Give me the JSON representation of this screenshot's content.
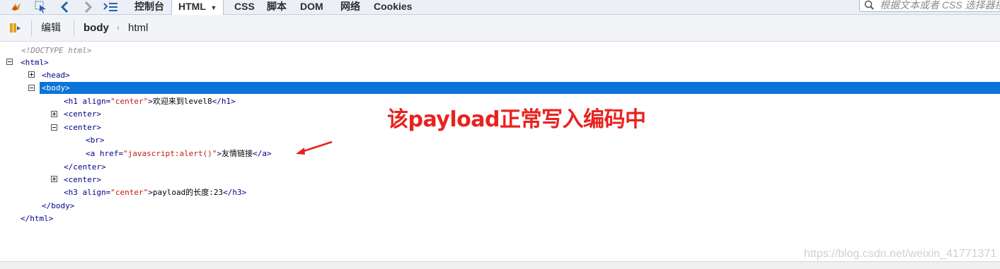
{
  "toolbar": {
    "tabs": [
      "控制台",
      "HTML",
      "CSS",
      "脚本",
      "DOM",
      "网络",
      "Cookies"
    ],
    "active_tab_index": 1,
    "search_placeholder": "根据文本或者 CSS 选择器搜"
  },
  "crumbbar": {
    "edit_label": "编辑",
    "crumbs": [
      "body",
      "html"
    ]
  },
  "tree": {
    "lines": [
      {
        "html": "<span class='comment'>&lt;!DOCTYPE html&gt;</span>"
      },
      {
        "html": "<span class='tag'>&lt;html&gt;</span>"
      },
      {
        "html": "<span class='tag'>&lt;head&gt;</span>"
      },
      {
        "html": "<span class='tag'>&lt;body&gt;</span>"
      },
      {
        "html": "<span class='tag'>&lt;h1</span> <span class='attr'>align=</span><span class='val'>\"center\"</span><span class='tag'>&gt;</span><span class='txt'>欢迎来到level8</span><span class='tag'>&lt;/h1&gt;</span>"
      },
      {
        "html": "<span class='tag'>&lt;center&gt;</span>"
      },
      {
        "html": "<span class='tag'>&lt;center&gt;</span>"
      },
      {
        "html": "<span class='tag'>&lt;br&gt;</span>"
      },
      {
        "html": "<span class='tag'>&lt;a</span> <span class='attr'>href=</span><span class='val'>\"javascript:alert()\"</span><span class='tag'>&gt;</span><span class='txt'>友情链接</span><span class='tag'>&lt;/a&gt;</span>"
      },
      {
        "html": "<span class='tag'>&lt;/center&gt;</span>"
      },
      {
        "html": "<span class='tag'>&lt;center&gt;</span>"
      },
      {
        "html": "<span class='tag'>&lt;h3</span> <span class='attr'>align=</span><span class='val'>\"center\"</span><span class='tag'>&gt;</span><span class='txt'>payload的长度:23</span><span class='tag'>&lt;/h3&gt;</span>"
      },
      {
        "html": "<span class='tag'>&lt;/body&gt;</span>"
      },
      {
        "html": "<span class='tag'>&lt;/html&gt;</span>"
      }
    ]
  },
  "annotation": {
    "text": "该payload正常写入编码中",
    "color": "#E8231F"
  },
  "watermark": "https://blog.csdn.net/weixin_41771371",
  "colors": {
    "selection": "#0A74D9",
    "tag": "#000088",
    "value": "#C41A16"
  }
}
